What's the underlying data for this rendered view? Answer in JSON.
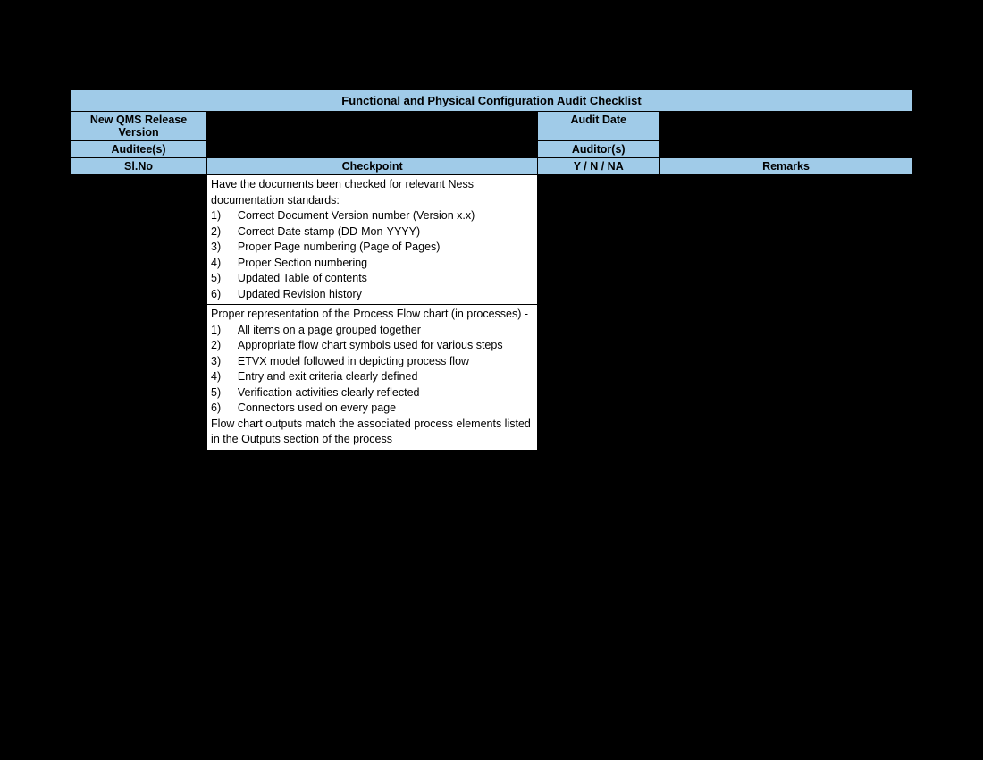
{
  "title": "Functional and Physical Configuration Audit Checklist",
  "labels": {
    "release_version": "New QMS Release Version",
    "audit_date": "Audit Date",
    "auditees": "Auditee(s)",
    "auditors": "Auditor(s)"
  },
  "columns": {
    "slno": "Sl.No",
    "checkpoint": "Checkpoint",
    "yn": "Y / N / NA",
    "remarks": "Remarks"
  },
  "rows": [
    {
      "checkpoint_lines": [
        "Have the documents been checked for relevant Ness documentation standards:",
        "1)   Correct Document Version number (Version x.x)",
        "2)   Correct Date stamp (DD-Mon-YYYY)",
        "3)   Proper Page numbering (Page of Pages)",
        "4)   Proper Section numbering",
        "5)   Updated Table of contents",
        "6)   Updated Revision history"
      ]
    },
    {
      "checkpoint_lines": [
        "Proper representation of the Process Flow chart (in processes) -",
        "1)   All items on a page grouped together",
        "2)   Appropriate flow chart symbols used for various steps",
        "3)   ETVX model followed in depicting process flow",
        "4)   Entry and exit criteria clearly defined",
        "5)   Verification activities clearly reflected",
        "6)   Connectors used on every page",
        "Flow chart outputs match the associated process elements listed in the Outputs section of the process"
      ]
    }
  ]
}
